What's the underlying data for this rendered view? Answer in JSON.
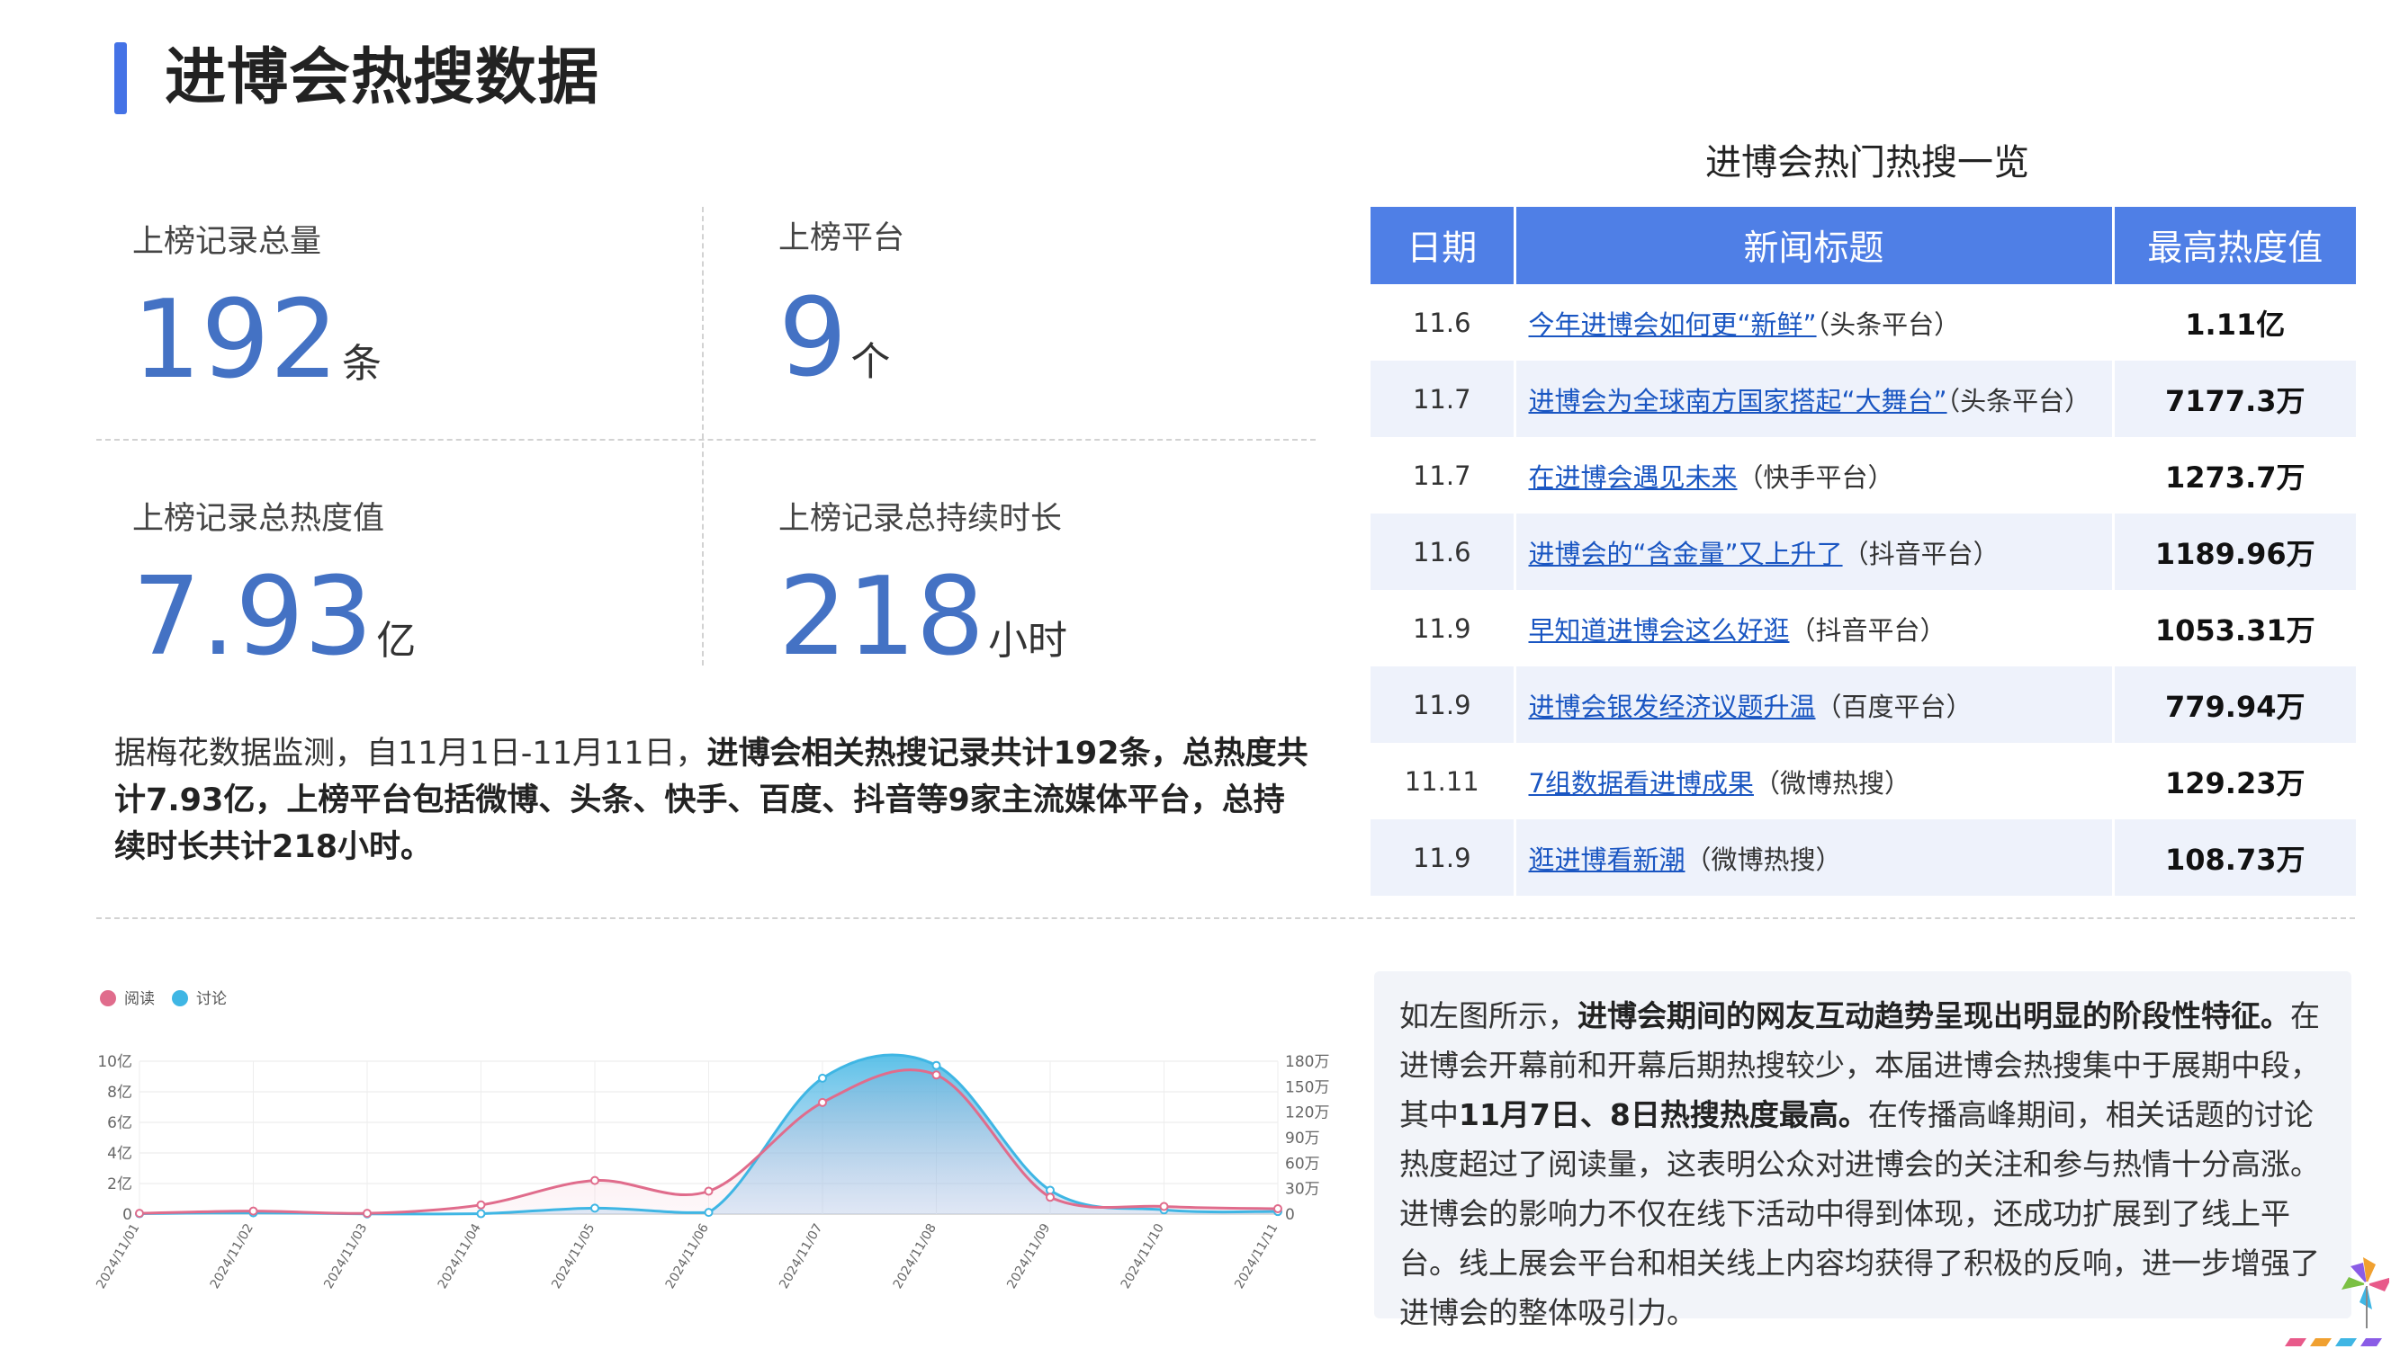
{
  "header": {
    "title": "进博会热搜数据"
  },
  "stats": {
    "records": {
      "label": "上榜记录总量",
      "value": "192",
      "unit": "条"
    },
    "platforms": {
      "label": "上榜平台",
      "value": "9",
      "unit": "个"
    },
    "heat": {
      "label": "上榜记录总热度值",
      "value": "7.93",
      "unit": "亿"
    },
    "duration": {
      "label": "上榜记录总持续时长",
      "value": "218",
      "unit": "小时"
    }
  },
  "summary": {
    "plain": "据梅花数据监测，自11月1日-11月11日，",
    "bold": "进博会相关热搜记录共计192条，总热度共计7.93亿，上榜平台包括微博、头条、快手、百度、抖音等9家主流媒体平台，总持续时长共计218小时。"
  },
  "table": {
    "title": "进博会热门热搜一览",
    "headers": [
      "日期",
      "新闻标题",
      "最高热度值"
    ],
    "rows": [
      {
        "date": "11.6",
        "title": "今年进博会如何更“新鲜”",
        "source": "（头条平台）",
        "heat": "1.11亿"
      },
      {
        "date": "11.7",
        "title": "进博会为全球南方国家搭起“大舞台”",
        "source": "（头条平台）",
        "heat": "7177.3万"
      },
      {
        "date": "11.7",
        "title": "在进博会遇见未来",
        "source": "（快手平台）",
        "heat": "1273.7万"
      },
      {
        "date": "11.6",
        "title": "进博会的“含金量”又上升了",
        "source": "（抖音平台）",
        "heat": "1189.96万"
      },
      {
        "date": "11.9",
        "title": "早知道进博会这么好逛",
        "source": "（抖音平台）",
        "heat": "1053.31万"
      },
      {
        "date": "11.9",
        "title": "进博会银发经济议题升温",
        "source": "（百度平台）",
        "heat": "779.94万"
      },
      {
        "date": "11.11",
        "title": "7组数据看进博成果",
        "source": "（微博热搜）",
        "heat": "129.23万"
      },
      {
        "date": "11.9",
        "title": "逛进博看新潮",
        "source": "（微博热搜）",
        "heat": "108.73万"
      }
    ]
  },
  "chart_data": {
    "type": "area",
    "categories": [
      "2024/11/01",
      "2024/11/02",
      "2024/11/03",
      "2024/11/04",
      "2024/11/05",
      "2024/11/06",
      "2024/11/07",
      "2024/11/08",
      "2024/11/09",
      "2024/11/10",
      "2024/11/11"
    ],
    "series": [
      {
        "name": "阅读",
        "axis": "left",
        "unit": "亿",
        "color": "#e06c8c",
        "values": [
          0.05,
          0.2,
          0.05,
          0.6,
          2.2,
          1.5,
          7.3,
          9.1,
          1.1,
          0.5,
          0.35
        ]
      },
      {
        "name": "讨论",
        "axis": "right",
        "unit": "万",
        "color": "#3fb6e4",
        "values": [
          0.5,
          1.5,
          0.3,
          0.5,
          7,
          2,
          160,
          175,
          28,
          5,
          3
        ]
      }
    ],
    "y_left": {
      "ticks": [
        "0",
        "2亿",
        "4亿",
        "6亿",
        "8亿",
        "10亿"
      ],
      "ylim": [
        0,
        10
      ]
    },
    "y_right": {
      "ticks": [
        "0",
        "30万",
        "60万",
        "90万",
        "120万",
        "150万",
        "180万"
      ],
      "ylim": [
        0,
        180
      ]
    },
    "legend_position": "top-left",
    "grid": true
  },
  "description": {
    "p1": "如左图所示，",
    "b1": "进博会期间的网友互动趋势呈现出明显的阶段性特征。",
    "p2": "在进博会开幕前和开幕后期热搜较少，本届进博会热搜集中于展期中段，其中",
    "b2": "11月7日、8日热搜热度最高。",
    "p3": "在传播高峰期间，相关话题的讨论热度超过了阅读量，这表明公众对进博会的关注和参与热情十分高涨。进博会的影响力不仅在线下活动中得到体现，还成功扩展到了线上平台。线上展会平台和相关线上内容均获得了积极的反响，进一步增强了进博会的整体吸引力。"
  }
}
